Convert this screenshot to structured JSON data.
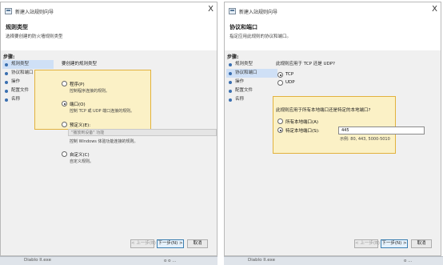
{
  "left": {
    "title": "新建入站规则向导",
    "close": "X",
    "header_title": "规则类型",
    "header_subtitle": "选择要创建的防火墙规则类型",
    "steps_title": "步骤:",
    "steps": [
      {
        "label": "规则类型"
      },
      {
        "label": "协议和端口"
      },
      {
        "label": "操作"
      },
      {
        "label": "配置文件"
      },
      {
        "label": "名称"
      }
    ],
    "prompt": "要创建的规则类型",
    "options": [
      {
        "label": "程序(P)",
        "desc": "控制程序连接的规则。",
        "selected": false
      },
      {
        "label": "端口(O)",
        "desc": "控制 TCP 或 UDP 端口连接的规则。",
        "selected": true
      },
      {
        "label": "预定义(E):",
        "desc": "控制 Windows 体验功能连接的规则。",
        "selected": false
      },
      {
        "label": "自定义(C)",
        "desc": "自定义规则。",
        "selected": false
      }
    ],
    "predefined_combo": "\"播放到设备\" 功能",
    "buttons": {
      "back": "< 上一步(B)",
      "next": "下一步(N) >",
      "cancel": "取消"
    },
    "taskbar": "Diablo II.exe",
    "taskbar_tail": "o  o  ..."
  },
  "right": {
    "title": "新建入站规则向导",
    "close": "X",
    "header_title": "协议和端口",
    "header_subtitle": "指定应用此规则的协议和端口。",
    "steps_title": "步骤:",
    "steps": [
      {
        "label": "规则类型"
      },
      {
        "label": "协议和端口"
      },
      {
        "label": "操作"
      },
      {
        "label": "配置文件"
      },
      {
        "label": "名称"
      }
    ],
    "protocol_prompt": "此规则应用于 TCP 还是 UDP?",
    "protocols": [
      {
        "label": "TCP",
        "selected": true
      },
      {
        "label": "UDP",
        "selected": false
      }
    ],
    "ports_prompt": "此规则应用于所有本地端口还是特定的本地端口?",
    "port_options": [
      {
        "label": "所有本地端口(A)",
        "selected": false
      },
      {
        "label": "特定本地端口(S):",
        "selected": true
      }
    ],
    "port_value": "445",
    "example": "示例: 80, 443, 5000-5010",
    "buttons": {
      "back": "< 上一步(B)",
      "next": "下一步(N) >",
      "cancel": "取消"
    },
    "taskbar": "Diablo II.exe",
    "taskbar_tail": "o  ..."
  }
}
